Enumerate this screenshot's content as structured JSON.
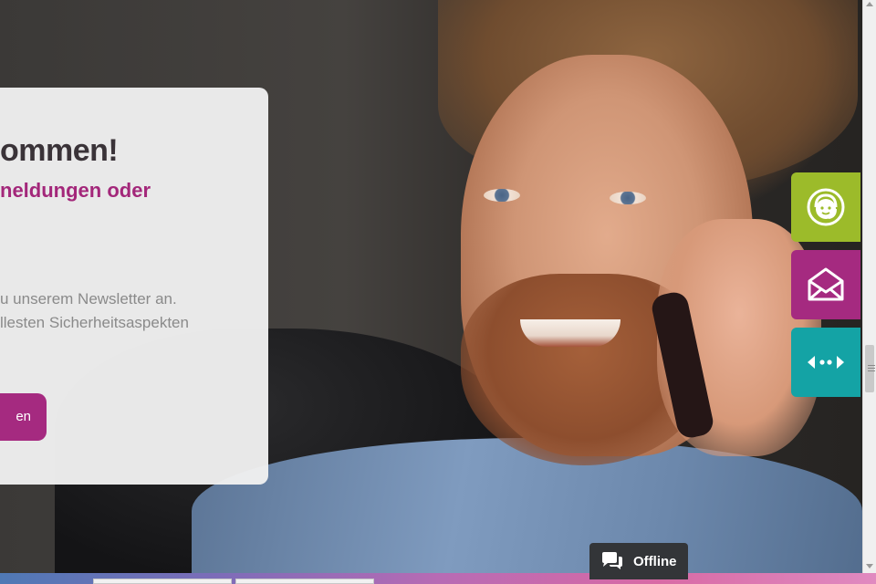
{
  "hero_card": {
    "title": "ommen!",
    "subtitle": "neldungen oder",
    "text_line1": "u unserem Newsletter an.",
    "text_line2": "llesten Sicherheitsaspekten",
    "button_label": "en"
  },
  "side_actions": [
    {
      "icon": "support-agent-icon",
      "color": "#9cbb2a"
    },
    {
      "icon": "mail-icon",
      "color": "#a52a80"
    },
    {
      "icon": "arrows-icon",
      "color": "#14a3a5"
    }
  ],
  "chat_widget": {
    "status_label": "Offline",
    "icon": "chat-bubbles-icon"
  },
  "colors": {
    "accent_purple": "#a52a80",
    "accent_green": "#9cbb2a",
    "accent_teal": "#14a3a5",
    "title_text": "#3a3338"
  }
}
